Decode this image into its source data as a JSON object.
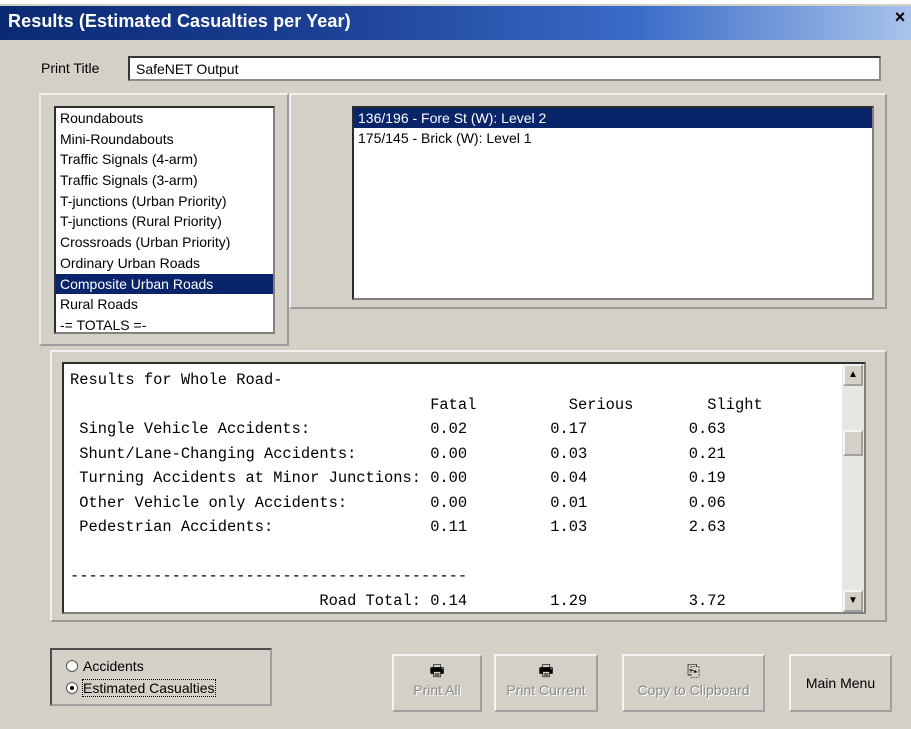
{
  "window": {
    "title": "Results (Estimated Casualties per Year)",
    "close_glyph": "×"
  },
  "print_title": {
    "label": "Print Title",
    "value": "SafeNET Output"
  },
  "categories": {
    "items": [
      "Roundabouts",
      "Mini-Roundabouts",
      "Traffic Signals (4-arm)",
      "Traffic Signals (3-arm)",
      "T-junctions (Urban Priority)",
      "T-junctions (Rural Priority)",
      "Crossroads (Urban Priority)",
      "Ordinary Urban Roads",
      "Composite Urban Roads",
      "Rural Roads",
      "-= TOTALS =-"
    ],
    "selected": "Composite Urban Roads"
  },
  "sites": {
    "items": [
      "136/196 - Fore St (W): Level 2",
      "175/145 - Brick (W): Level 1"
    ],
    "selected": "136/196 - Fore St (W): Level 2"
  },
  "results": {
    "heading": "Results for Whole Road-",
    "columns": [
      "Fatal",
      "Serious",
      "Slight"
    ],
    "rows": [
      {
        "label": "Single Vehicle Accidents:",
        "fatal": "0.02",
        "serious": "0.17",
        "slight": "0.63"
      },
      {
        "label": "Shunt/Lane-Changing Accidents:",
        "fatal": "0.00",
        "serious": "0.03",
        "slight": "0.21"
      },
      {
        "label": "Turning Accidents at Minor Junctions:",
        "fatal": "0.00",
        "serious": "0.04",
        "slight": "0.19"
      },
      {
        "label": "Other Vehicle only Accidents:",
        "fatal": "0.00",
        "serious": "0.01",
        "slight": "0.06"
      },
      {
        "label": "Pedestrian Accidents:",
        "fatal": "0.11",
        "serious": "1.03",
        "slight": "2.63"
      }
    ],
    "divider": "-------------------------------------------",
    "total": {
      "label": "Road Total:",
      "fatal": "0.14",
      "serious": "1.29",
      "slight": "3.72"
    }
  },
  "mode": {
    "options": [
      "Accidents",
      "Estimated Casualties"
    ],
    "selected": "Estimated Casualties"
  },
  "buttons": {
    "print_all": {
      "label": "Print All",
      "icon": "printer-icon",
      "enabled": false
    },
    "print_current": {
      "label": "Print Current",
      "icon": "printer-icon",
      "enabled": false
    },
    "copy_clipboard": {
      "label": "Copy to Clipboard",
      "icon": "clipboard-icon",
      "enabled": false
    },
    "main_menu": {
      "label": "Main Menu",
      "enabled": true
    }
  }
}
